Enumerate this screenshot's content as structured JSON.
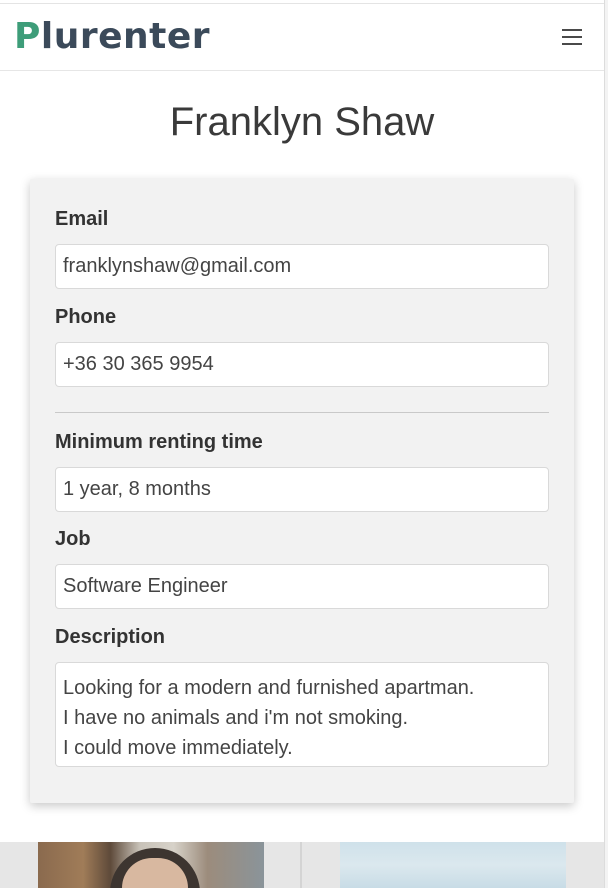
{
  "navbar": {
    "logo_first_letter": "P",
    "logo_rest": "lurenter",
    "menu_icon": "hamburger-menu-icon"
  },
  "profile": {
    "name": "Franklyn Shaw"
  },
  "form": {
    "email_label": "Email",
    "email_value": "franklynshaw@gmail.com",
    "phone_label": "Phone",
    "phone_value": "+36 30 365 9954",
    "min_renting_label": "Minimum renting time",
    "min_renting_value": "1 year, 8 months",
    "job_label": "Job",
    "job_value": "Software Engineer",
    "description_label": "Description",
    "description_lines": [
      "Looking for a modern and furnished apartman.",
      "I have no animals and i'm not smoking.",
      "I could move immediately."
    ]
  },
  "colors": {
    "logo_accent": "#3e9d79",
    "logo_text": "#3b4a5a",
    "card_background": "#f2f2f2"
  }
}
